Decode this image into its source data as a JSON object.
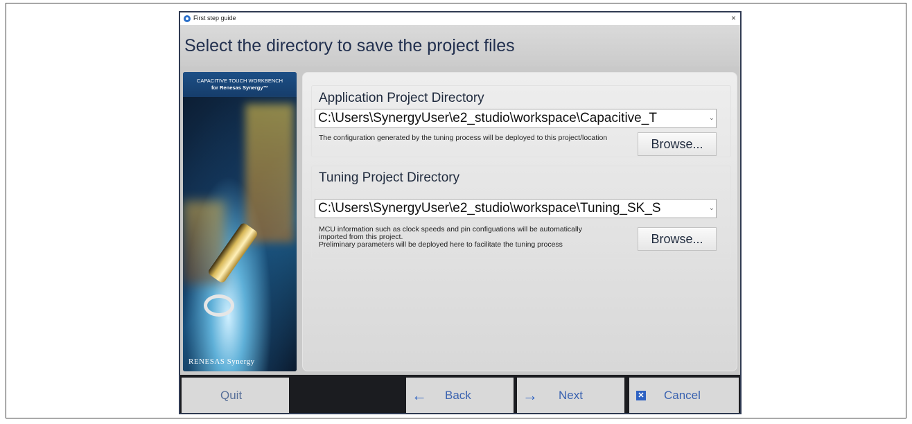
{
  "window": {
    "title": "First step guide",
    "close_symbol": "×",
    "heading": "Select the directory to save the project files"
  },
  "sidebar": {
    "banner_line1": "CAPACITIVE TOUCH WORKBENCH",
    "banner_line2": "for Renesas Synergy™",
    "logo_text": "RENESAS Synergy"
  },
  "application": {
    "label": "Application Project Directory",
    "path": "C:\\Users\\SynergyUser\\e2_studio\\workspace\\Capacitive_T",
    "description": "The configuration generated by the tuning process will be deployed to this project/location",
    "browse_label": "Browse..."
  },
  "tuning": {
    "label": "Tuning Project Directory",
    "path": "C:\\Users\\SynergyUser\\e2_studio\\workspace\\Tuning_SK_S",
    "description_line1": "MCU information such as clock speeds and pin configuations will be automatically imported from this project.",
    "description_line2": "Preliminary parameters will be deployed here to facilitate the tuning process",
    "browse_label": "Browse..."
  },
  "nav": {
    "quit": "Quit",
    "back": "Back",
    "next": "Next",
    "cancel": "Cancel",
    "back_arrow": "←",
    "next_arrow": "→",
    "cancel_icon": "✕"
  },
  "colors": {
    "accent": "#2e62c2",
    "heading": "#22304f",
    "background_dark": "#1b1c20"
  },
  "icons": {
    "app": "app-logo-icon",
    "close": "close-icon",
    "dropdown": "chevron-down-icon",
    "back": "arrow-left-icon",
    "next": "arrow-right-icon",
    "cancel": "cancel-x-icon"
  }
}
